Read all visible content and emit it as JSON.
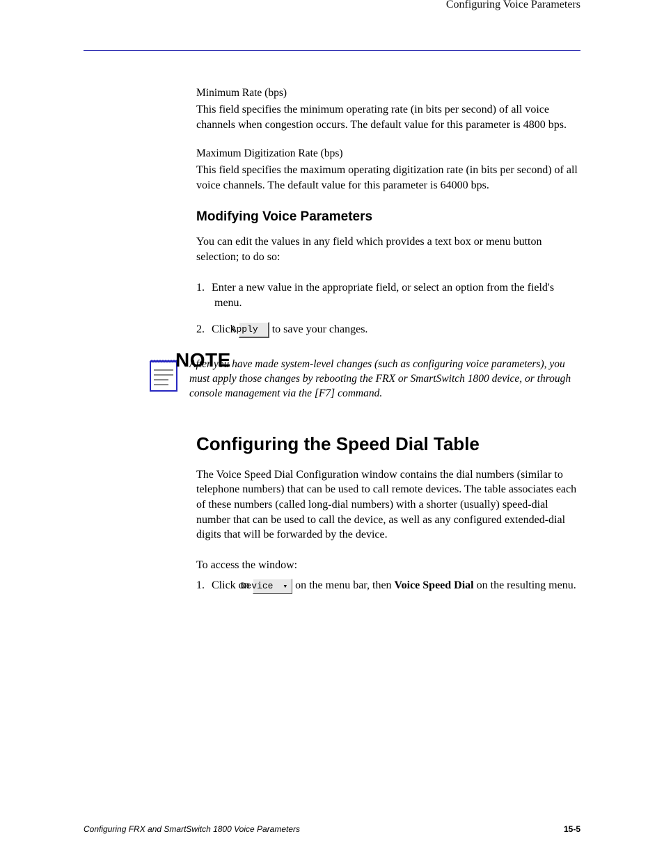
{
  "header": {
    "right_label": "Configuring Voice Parameters"
  },
  "min_rate": {
    "heading": "Minimum Rate (bps)",
    "text": "This field specifies the minimum operating rate (in bits per second) of all voice channels when congestion occurs. The default value for this parameter is 4800 bps."
  },
  "max_rate": {
    "heading": "Maximum Digitization Rate (bps)",
    "text": "This field specifies the maximum operating digitization rate (in bits per second) of all voice channels. The default value for this parameter is 64000 bps."
  },
  "modify": {
    "heading": "Modifying Voice Parameters",
    "intro": "You can edit the values in any field which provides a text box or menu button selection; to do so:",
    "step1": "Enter a new value in the appropriate field, or select an option from the field's menu.",
    "step2_pre": "Click ",
    "apply_label": "Apply",
    "step2_post": " to save your changes."
  },
  "note": {
    "label": "NOTE",
    "text": "After you have made system-level changes (such as configuring voice parameters), you must apply those changes by rebooting the FRX or SmartSwitch 1800 device, or through console management via the [F7] command."
  },
  "speed_dial": {
    "heading": "Configuring the Speed Dial Table",
    "intro": "The Voice Speed Dial Configuration window contains the dial numbers (similar to telephone numbers) that can be used to call remote devices. The table associates each of these numbers (called long-dial numbers) with a shorter (usually) speed-dial number that can be used to call the device, as well as any configured extended-dial digits that will be forwarded by the device.",
    "access": "To access the window:",
    "step1_pre": "Click on ",
    "device_label": "Device",
    "step1_mid": " on the menu bar, then ",
    "step1_bold": "Voice Speed Dial",
    "step1_post": " on the resulting menu."
  },
  "footer": {
    "left": "Configuring FRX and SmartSwitch 1800 Voice Parameters",
    "right": "15-5"
  }
}
